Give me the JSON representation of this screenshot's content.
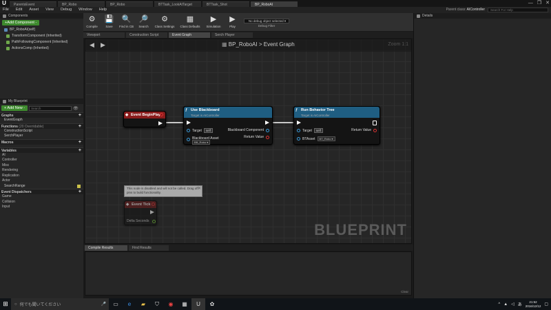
{
  "window": {
    "tabs": [
      "ParentsEvent",
      "BP_Robo",
      "BP_Robo",
      "BTTask_LookAtTarget",
      "BTTask_Shot",
      "BP_RoboAI"
    ],
    "controls": [
      "—",
      "❐",
      "✕"
    ]
  },
  "menu": {
    "items": [
      "File",
      "Edit",
      "Asset",
      "View",
      "Debug",
      "Window",
      "Help"
    ],
    "parent_class_label": "Parent class:",
    "parent_class_value": "AIController",
    "help_placeholder": "Search For Help"
  },
  "components": {
    "title": "Components",
    "add_label": "+Add Component -",
    "root": "BP_RoboAI(self)",
    "items": [
      "TransformComponent (Inherited)",
      "PathFollowingComponent (Inherited)",
      "ActionsComp (Inherited)"
    ]
  },
  "myblueprint": {
    "title": "My Blueprint",
    "add_new": "+ Add New -",
    "search_placeholder": "Search",
    "graphs_label": "Graphs",
    "graph_items": [
      "EventGraph"
    ],
    "functions_label": "Functions",
    "functions_note": "(20 Overridable)",
    "function_items": [
      "ConstructionScript",
      "SerchPlayer"
    ],
    "macros_label": "Macros",
    "variables_label": "Variables",
    "var_categories": [
      "AI",
      "Controller",
      "Misc",
      "Rendering",
      "Replication",
      "Actor"
    ],
    "var_items": [
      "SearchRange"
    ],
    "dispatchers_label": "Event Dispatchers",
    "dispatcher_categories": [
      "Game",
      "Collision",
      "Input"
    ]
  },
  "toolbar": {
    "buttons": [
      {
        "label": "Compile",
        "icon": "⚙"
      },
      {
        "label": "Save",
        "icon": "💾"
      },
      {
        "label": "Find in CB",
        "icon": "🔍"
      },
      {
        "label": "Search",
        "icon": "🔎"
      },
      {
        "label": "Class Settings",
        "icon": "⚙"
      },
      {
        "label": "Class Defaults",
        "icon": "▦"
      },
      {
        "label": "Simulation",
        "icon": "▶"
      },
      {
        "label": "Play",
        "icon": "▶"
      }
    ],
    "debug_select": "No debug object selected ▾",
    "debug_filter": "Debug Filter"
  },
  "editor_tabs": [
    "Viewport",
    "Construction Script",
    "Event Graph",
    "Serch Player"
  ],
  "graph": {
    "crumb_root": "BP_RoboAI",
    "crumb_sep": ">",
    "crumb_page": "Event Graph",
    "zoom": "Zoom 1:1",
    "watermark": "BLUEPRINT",
    "node_begin": {
      "title": "Event BeginPlay"
    },
    "node_blackboard": {
      "title": "Use Blackboard",
      "subtitle": "Target is AIController",
      "target_label": "Target",
      "target_value": "self",
      "asset_label": "Blackboard Asset",
      "asset_value": "BB_Robo ▾",
      "out_label": "Blackboard Component",
      "return_label": "Return Value"
    },
    "node_behavior": {
      "title": "Run Behavior Tree",
      "subtitle": "Target is AIController",
      "target_label": "Target",
      "target_value": "self",
      "bt_label": "BTAsset",
      "bt_value": "BT_Robo ▾",
      "return_label": "Return Value"
    },
    "tooltip": "This node is disabled and will not be called. Drag off pins to build functionality.",
    "node_tick": {
      "title": "Event Tick",
      "delta_label": "Delta Seconds"
    }
  },
  "bottom": {
    "tabs": [
      "Compile Results",
      "Find Results"
    ],
    "clear": "Clear"
  },
  "details": {
    "title": "Details"
  },
  "taskbar": {
    "search_text": "何でも聞いてください",
    "time": "21:52",
    "date": "2016/12/12"
  },
  "colors": {
    "event_red": "#8a1c1c",
    "function_blue": "#1f5e82",
    "accent_green": "#3e8a2e"
  }
}
